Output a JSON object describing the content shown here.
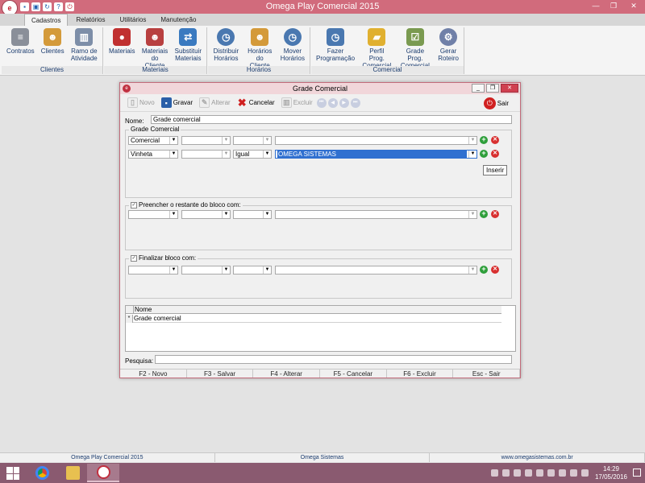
{
  "app": {
    "title": "Omega Play Comercial 2015",
    "logo_text": "e"
  },
  "quick_access": [
    "save-icon",
    "lock-icon",
    "refresh-icon",
    "help-icon",
    "power-icon"
  ],
  "ribbon": {
    "tabs": [
      "Cadastros",
      "Relatórios",
      "Utilitários",
      "Manutenção"
    ],
    "groups": {
      "clientes": {
        "label": "Clientes",
        "buttons": [
          "Contratos",
          "Clientes",
          "Ramo de Atividade"
        ]
      },
      "materiais": {
        "label": "Materiais",
        "buttons": [
          "Materiais",
          "Materiais do Cliente",
          "Substituir Materiais"
        ]
      },
      "horarios": {
        "label": "Horários",
        "buttons": [
          "Distribuir Horários",
          "Horários do Cliente",
          "Mover Horários"
        ]
      },
      "comercial": {
        "label": "Comercial",
        "buttons": [
          "Fazer Programação",
          "Perfil Prog. Comercial",
          "Grade Prog. Comercial",
          "Gerar Roteiro"
        ]
      }
    }
  },
  "dialog": {
    "title": "Grade Comercial",
    "toolbar": {
      "novo": "Novo",
      "gravar": "Gravar",
      "alterar": "Alterar",
      "cancelar": "Cancelar",
      "excluir": "Excluir",
      "sair": "Sair"
    },
    "nome_label": "Nome:",
    "nome_value": "Grade comercial",
    "grade": {
      "legend": "Grade Comercial",
      "row1": {
        "c1": "Comercial",
        "c2": "",
        "c3": "",
        "c4": ""
      },
      "row2": {
        "c1": "Vinheta",
        "c2": "",
        "c3": "Igual",
        "c4": "OMEGA SISTEMAS"
      },
      "tooltip": "Inserir"
    },
    "preencher": {
      "legend": "Preencher o restante do bloco com:",
      "checked": true,
      "row": {
        "c1": "",
        "c2": "",
        "c3": "",
        "c4": ""
      }
    },
    "finalizar": {
      "legend": "Finalizar bloco com:",
      "checked": true,
      "row": {
        "c1": "",
        "c2": "",
        "c3": "",
        "c4": ""
      }
    },
    "table": {
      "columns": [
        "Nome"
      ],
      "rows": [
        {
          "nome": "Grade comercial"
        }
      ],
      "new_row_marker": "*"
    },
    "pesquisa_label": "Pesquisa:",
    "pesquisa_value": "",
    "fkeys": [
      "F2 - Novo",
      "F3 - Salvar",
      "F4 - Alterar",
      "F5 - Cancelar",
      "F6 - Excluir",
      "Esc - Sair"
    ]
  },
  "statusbar": [
    "Omega Play Comercial 2015",
    "Omega Sistemas",
    "www.omegasistemas.com.br"
  ],
  "taskbar": {
    "time": "14:29",
    "date": "17/05/2016"
  }
}
